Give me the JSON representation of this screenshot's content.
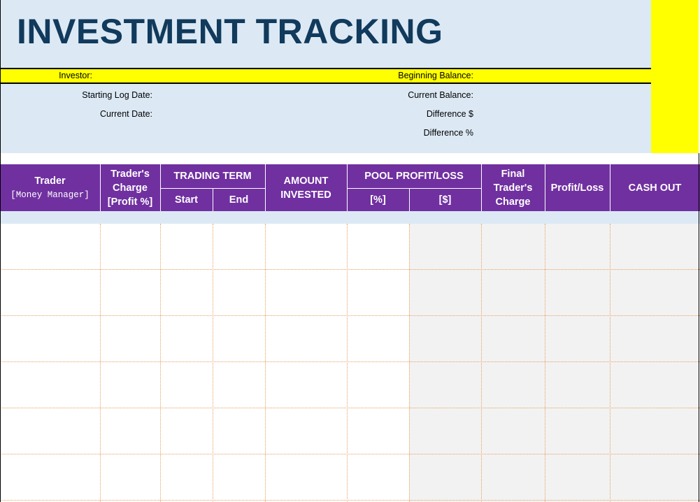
{
  "title": "INVESTMENT TRACKING",
  "info": {
    "investor_label": "Investor:",
    "beginning_balance_label": "Beginning Balance:",
    "starting_log_date_label": "Starting Log Date:",
    "current_date_label": "Current Date:",
    "current_balance_label": "Current Balance:",
    "difference_dollar_label": "Difference $",
    "difference_percent_label": "Difference %"
  },
  "table": {
    "headers": {
      "trader": "Trader",
      "trader_sub": "[Money Manager]",
      "traders_charge_1": "Trader's",
      "traders_charge_2": "Charge",
      "traders_charge_3": "[Profit %]",
      "trading_term": "TRADING TERM",
      "start": "Start",
      "end": "End",
      "amount_invested_1": "AMOUNT",
      "amount_invested_2": "INVESTED",
      "pool_profit_loss": "POOL PROFIT/LOSS",
      "pool_percent": "[%]",
      "pool_dollar": "[$]",
      "final_charge_1": "Final",
      "final_charge_2": "Trader's",
      "final_charge_3": "Charge",
      "profit_loss": "Profit/Loss",
      "cash_out": "CASH OUT"
    },
    "rows": [
      {
        "trader": "",
        "charge": "",
        "start": "",
        "end": "",
        "amount": "",
        "pool_pct": "",
        "pool_usd": "",
        "final_charge": "",
        "profit_loss": "",
        "cash_out": ""
      },
      {
        "trader": "",
        "charge": "",
        "start": "",
        "end": "",
        "amount": "",
        "pool_pct": "",
        "pool_usd": "",
        "final_charge": "",
        "profit_loss": "",
        "cash_out": ""
      },
      {
        "trader": "",
        "charge": "",
        "start": "",
        "end": "",
        "amount": "",
        "pool_pct": "",
        "pool_usd": "",
        "final_charge": "",
        "profit_loss": "",
        "cash_out": ""
      },
      {
        "trader": "",
        "charge": "",
        "start": "",
        "end": "",
        "amount": "",
        "pool_pct": "",
        "pool_usd": "",
        "final_charge": "",
        "profit_loss": "",
        "cash_out": ""
      },
      {
        "trader": "",
        "charge": "",
        "start": "",
        "end": "",
        "amount": "",
        "pool_pct": "",
        "pool_usd": "",
        "final_charge": "",
        "profit_loss": "",
        "cash_out": ""
      },
      {
        "trader": "",
        "charge": "",
        "start": "",
        "end": "",
        "amount": "",
        "pool_pct": "",
        "pool_usd": "",
        "final_charge": "",
        "profit_loss": "",
        "cash_out": ""
      }
    ]
  },
  "colors": {
    "header_band": "#dce9f5",
    "highlight_yellow": "#ffff00",
    "title_text": "#113a5c",
    "table_header": "#7030a0",
    "computed_cells": "#f2f2f2",
    "grid_lines": "#e8a060"
  }
}
